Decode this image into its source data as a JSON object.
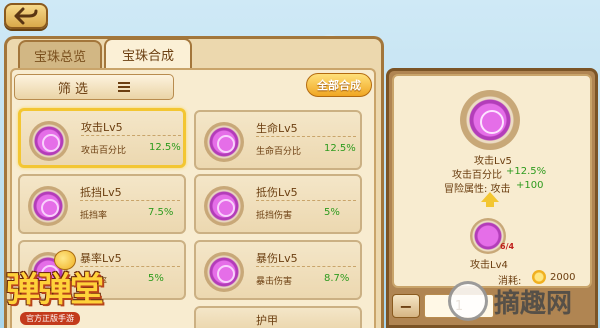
{
  "tabs": [
    {
      "label": "宝珠总览"
    },
    {
      "label": "宝珠合成"
    }
  ],
  "toolbar": {
    "filter_label": "筛  选",
    "compose_all_label": "全部合成"
  },
  "gems": [
    {
      "name": "攻击Lv5",
      "stat": "攻击百分比",
      "value": "12.5%",
      "selected": true
    },
    {
      "name": "生命Lv5",
      "stat": "生命百分比",
      "value": "12.5%",
      "selected": false
    },
    {
      "name": "抵挡Lv5",
      "stat": "抵挡率",
      "value": "7.5%",
      "selected": false
    },
    {
      "name": "抵伤Lv5",
      "stat": "抵挡伤害",
      "value": "5%",
      "selected": false
    },
    {
      "name": "暴率Lv5",
      "stat": "暴击率",
      "value": "5%",
      "selected": false
    },
    {
      "name": "暴伤Lv5",
      "stat": "暴击伤害",
      "value": "8.7%",
      "selected": false
    },
    {
      "name": "护甲",
      "stat": "",
      "value": "",
      "selected": false
    }
  ],
  "detail": {
    "target_name": "攻击Lv5",
    "target_stat": "攻击百分比",
    "target_value": "+12.5%",
    "adventure_label": "冒险属性: 攻击",
    "adventure_value": "+100",
    "source_name": "攻击Lv4",
    "source_badge": "6/4",
    "cost_label": "消耗:",
    "cost_value": "2000"
  },
  "stepper": {
    "minus": "−",
    "value": "1",
    "plus": "+"
  },
  "logo": {
    "title": "弹弹堂",
    "subtitle": "官方正版手游"
  },
  "watermark": {
    "text": "摘趣网"
  },
  "colors": {
    "accent_gold": "#f3c632",
    "value_green": "#2e9b1e",
    "panel_brown": "#a3763b",
    "gem_purple": "#b33db9"
  }
}
